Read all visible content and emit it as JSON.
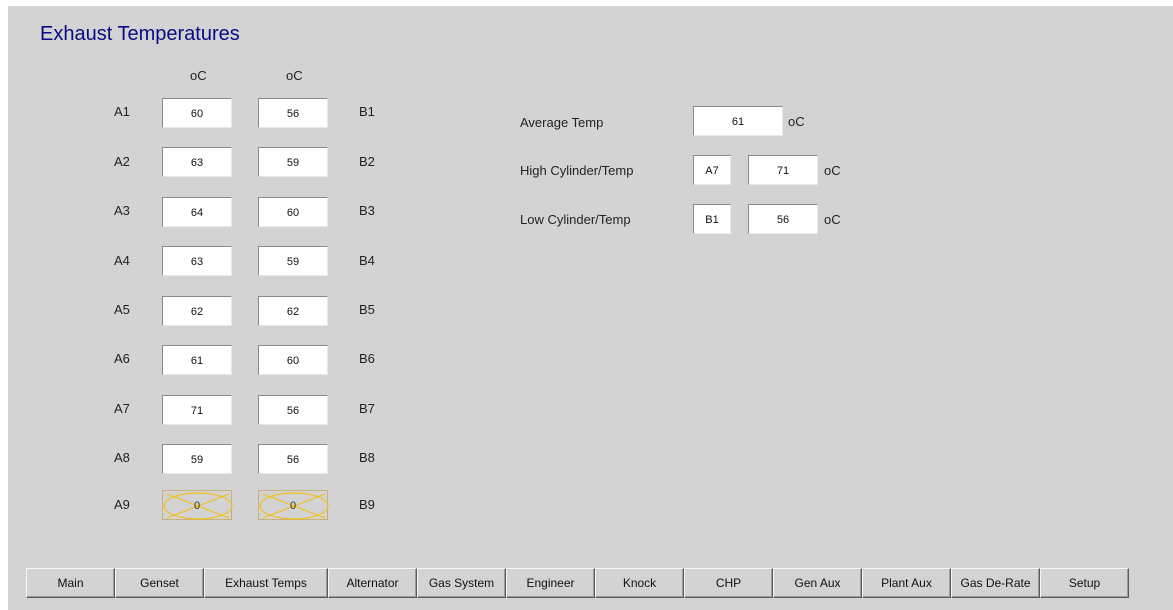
{
  "title": "Exhaust Temperatures",
  "unit_headers": [
    "oC",
    "oC"
  ],
  "rows": [
    {
      "a_label": "A1",
      "a_value": "60",
      "b_value": "56",
      "b_label": "B1"
    },
    {
      "a_label": "A2",
      "a_value": "63",
      "b_value": "59",
      "b_label": "B2"
    },
    {
      "a_label": "A3",
      "a_value": "64",
      "b_value": "60",
      "b_label": "B3"
    },
    {
      "a_label": "A4",
      "a_value": "63",
      "b_value": "59",
      "b_label": "B4"
    },
    {
      "a_label": "A5",
      "a_value": "62",
      "b_value": "62",
      "b_label": "B5"
    },
    {
      "a_label": "A6",
      "a_value": "61",
      "b_value": "60",
      "b_label": "B6"
    },
    {
      "a_label": "A7",
      "a_value": "71",
      "b_value": "56",
      "b_label": "B7"
    },
    {
      "a_label": "A8",
      "a_value": "59",
      "b_value": "56",
      "b_label": "B8"
    },
    {
      "a_label": "A9",
      "a_value": "0",
      "b_value": "0",
      "b_label": "B9"
    }
  ],
  "stats": {
    "average": {
      "label": "Average Temp",
      "value": "61",
      "unit": "oC"
    },
    "high": {
      "label": "High Cylinder/Temp",
      "cylinder": "A7",
      "value": "71",
      "unit": "oC"
    },
    "low": {
      "label": "Low Cylinder/Temp",
      "cylinder": "B1",
      "value": "56",
      "unit": "oC"
    }
  },
  "nav": [
    "Main",
    "Genset",
    "Exhaust Temps",
    "Alternator",
    "Gas System",
    "Engineer",
    "Knock",
    "CHP",
    "Gen Aux",
    "Plant Aux",
    "Gas De-Rate",
    "Setup"
  ],
  "colors": {
    "panel_bg": "#d3d3d3",
    "title_color": "#0a0a84",
    "alarm_outline": "#f0c020"
  }
}
